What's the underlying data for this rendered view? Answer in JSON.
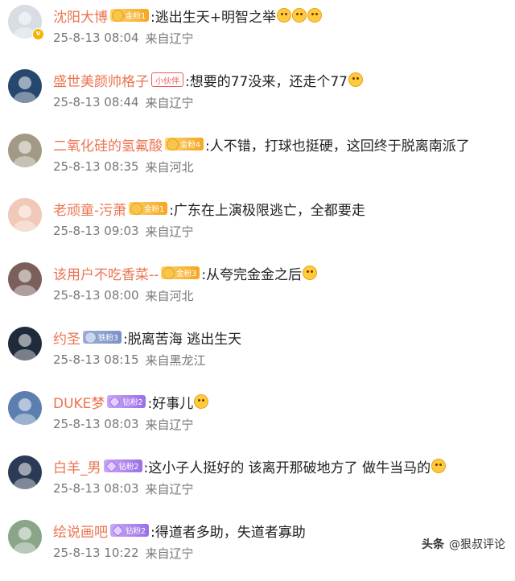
{
  "comments": [
    {
      "user": "沈阳大博",
      "badge": {
        "type": "gold",
        "label": "金粉1"
      },
      "text": ":逃出生天+明智之举",
      "emoji_count": 3,
      "date": "25-8-13 08:04",
      "location": "来自辽宁",
      "avatar_color": "#d8dde4",
      "verified": true
    },
    {
      "user": "盛世美颜帅格子",
      "badge": {
        "type": "partner",
        "label": "小伙伴"
      },
      "text": ":想要的77没来，还走个77",
      "emoji_count": 1,
      "date": "25-8-13 08:44",
      "location": "来自辽宁",
      "avatar_color": "#27486e",
      "verified": false
    },
    {
      "user": "二氧化硅的氢氟酸",
      "badge": {
        "type": "gold",
        "label": "金粉4"
      },
      "text": ":人不错，打球也挺硬，这回终于脱离南派了",
      "emoji_count": 0,
      "date": "25-8-13 08:35",
      "location": "来自河北",
      "avatar_color": "#a39a86",
      "verified": false
    },
    {
      "user": "老顽童-污萧",
      "badge": {
        "type": "gold",
        "label": "金粉1"
      },
      "text": ":广东在上演极限逃亡，全都要走",
      "emoji_count": 0,
      "date": "25-8-13 09:03",
      "location": "来自辽宁",
      "avatar_color": "#f1c9b8",
      "verified": false
    },
    {
      "user": "该用户不吃香菜--",
      "badge": {
        "type": "gold",
        "label": "金粉3"
      },
      "text": ":从夸完金金之后",
      "emoji_count": 1,
      "date": "25-8-13 08:00",
      "location": "来自河北",
      "avatar_color": "#7b5f5a",
      "verified": false
    },
    {
      "user": "约圣",
      "badge": {
        "type": "iron",
        "label": "铁粉3"
      },
      "text": ":脱离苦海 逃出生天",
      "emoji_count": 0,
      "date": "25-8-13 08:15",
      "location": "来自黑龙江",
      "avatar_color": "#1f2a3a",
      "verified": false
    },
    {
      "user": "DUKE梦",
      "badge": {
        "type": "diamond",
        "label": "钻粉2"
      },
      "text": ":好事儿",
      "emoji_count": 1,
      "date": "25-8-13 08:03",
      "location": "来自辽宁",
      "avatar_color": "#5d7fb0",
      "verified": false
    },
    {
      "user": "白羊_男",
      "badge": {
        "type": "diamond",
        "label": "钻粉2"
      },
      "text": ":这小子人挺好的  该离开那破地方了  做牛当马的",
      "emoji_count": 1,
      "date": "25-8-13 08:03",
      "location": "来自辽宁",
      "avatar_color": "#2b3a55",
      "verified": false
    },
    {
      "user": "绘说画吧",
      "badge": {
        "type": "diamond",
        "label": "钻粉2"
      },
      "text": ":得道者多助，失道者寡助",
      "emoji_count": 0,
      "date": "25-8-13 10:22",
      "location": "来自辽宁",
      "avatar_color": "#8aa58a",
      "verified": false
    }
  ],
  "watermark": {
    "brand": "头条",
    "account": "@狠叔评论"
  },
  "colors": {
    "username": "#eb7350",
    "meta": "#777777"
  }
}
